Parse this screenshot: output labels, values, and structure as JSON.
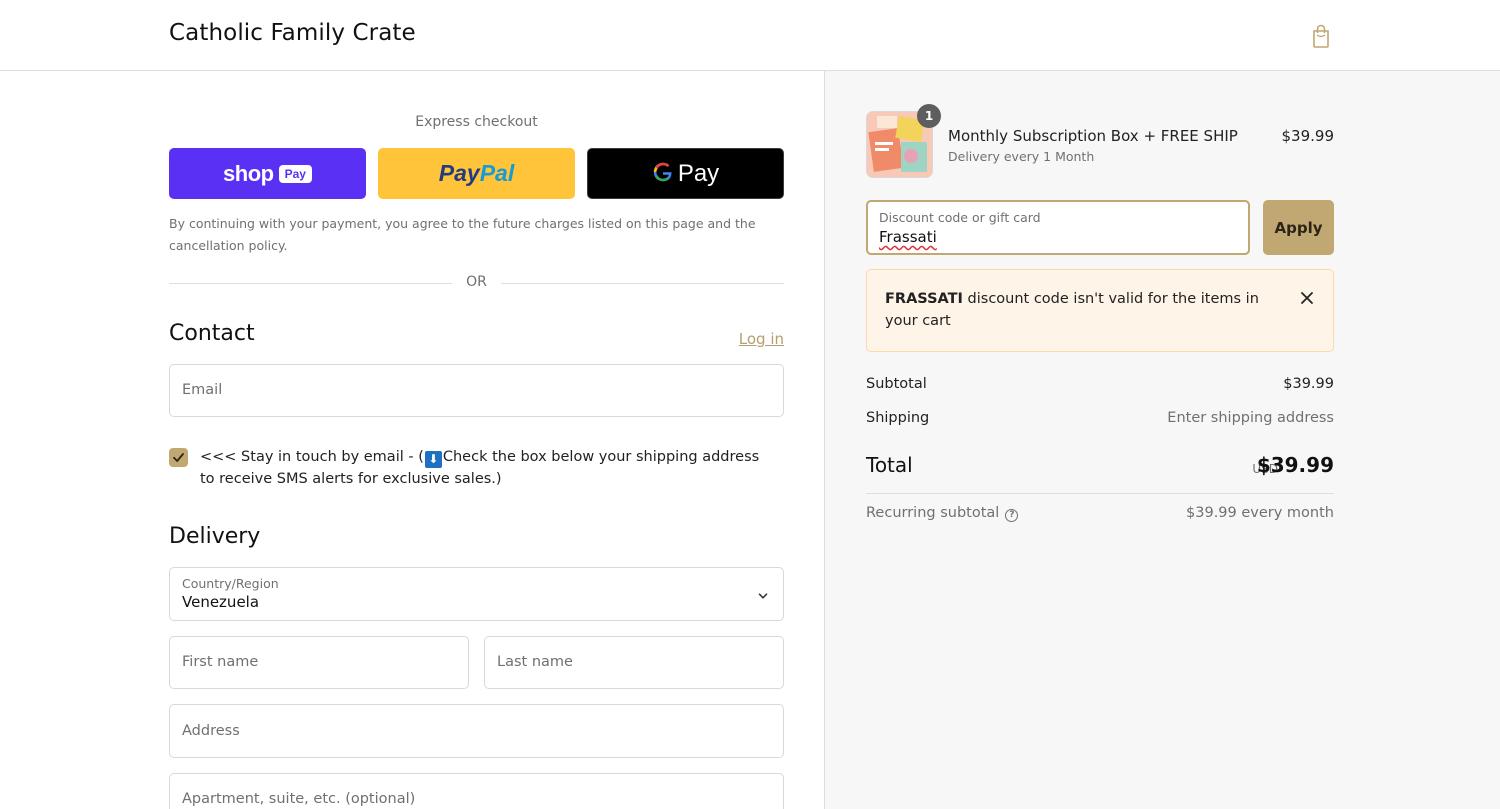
{
  "header": {
    "store_name": "Catholic Family Crate",
    "cart_icon": "shopping-bag-icon"
  },
  "express": {
    "label": "Express checkout",
    "shop_pay": {
      "word": "shop",
      "tag": "Pay"
    },
    "paypal": {
      "part1": "Pay",
      "part2": "Pal"
    },
    "gpay": {
      "g": "G",
      "word": "Pay"
    },
    "agreement": "By continuing with your payment, you agree to the future charges listed on this page and the cancellation policy.",
    "or": "OR"
  },
  "contact": {
    "title": "Contact",
    "login": "Log in",
    "email_placeholder": "Email",
    "newsletter_checked": true,
    "newsletter_text_before": "<<< Stay in touch by email - (",
    "newsletter_arrow": "⬇",
    "newsletter_text_after": "Check the box below your shipping address to receive SMS alerts for exclusive sales.)"
  },
  "delivery": {
    "title": "Delivery",
    "country_label": "Country/Region",
    "country_value": "Venezuela",
    "first_name_placeholder": "First name",
    "last_name_placeholder": "Last name",
    "address_placeholder": "Address",
    "apartment_placeholder": "Apartment, suite, etc. (optional)"
  },
  "summary": {
    "item": {
      "quantity": "1",
      "title": "Monthly Subscription Box + FREE SHIP",
      "subtitle": "Delivery every 1 Month",
      "price": "$39.99"
    },
    "discount": {
      "label": "Discount code or gift card",
      "value": "Frassati",
      "apply": "Apply"
    },
    "alert": {
      "code": "FRASSATI",
      "message": "discount code isn't valid for the items in your cart"
    },
    "subtotal_label": "Subtotal",
    "subtotal_value": "$39.99",
    "shipping_label": "Shipping",
    "shipping_value": "Enter shipping address",
    "total_label": "Total",
    "total_currency": "USD",
    "total_value": "$39.99",
    "recurring_label": "Recurring subtotal",
    "recurring_value": "$39.99 every month"
  },
  "colors": {
    "accent": "#c1a771",
    "shop_pay": "#5a31f4",
    "paypal": "#ffc439",
    "alert_bg": "#fff4e8"
  }
}
